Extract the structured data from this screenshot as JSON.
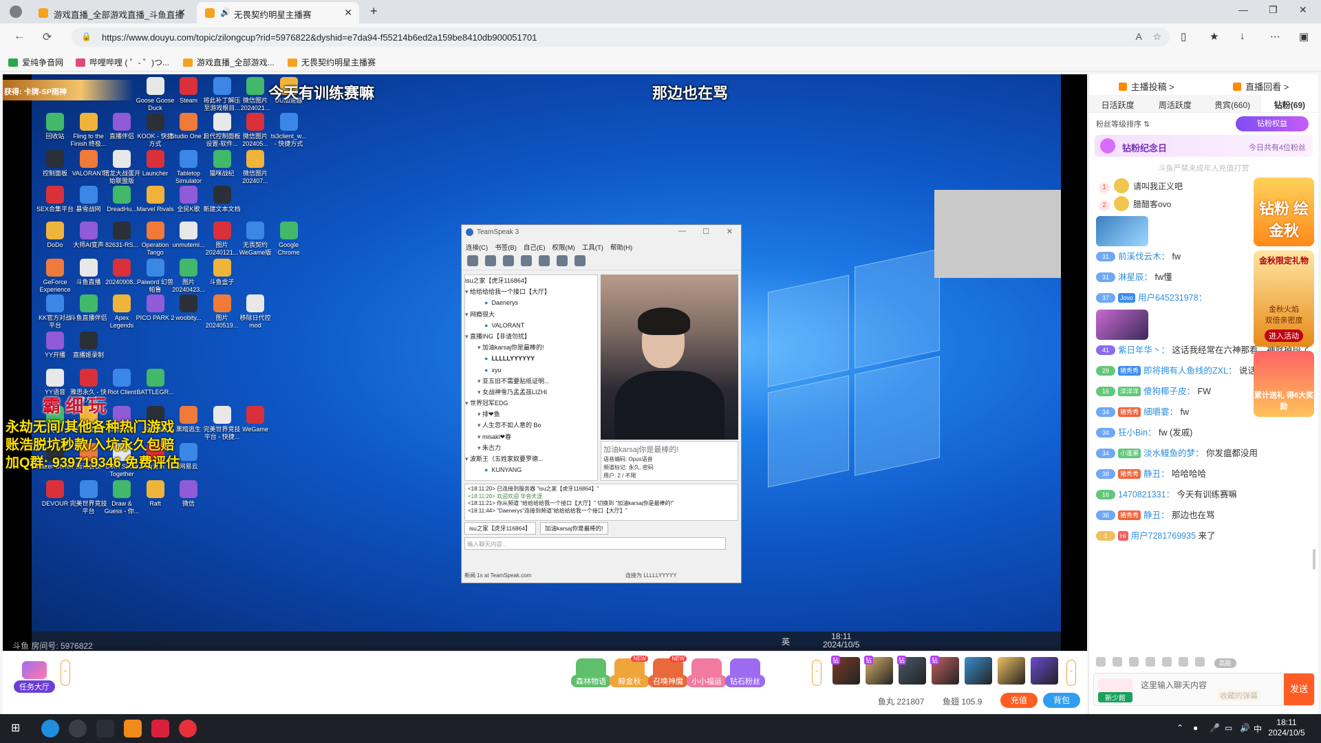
{
  "browser": {
    "tabs": [
      {
        "label": "游戏直播_全部游戏直播_斗鱼直播",
        "active": false
      },
      {
        "label": "无畏契约明星主播赛",
        "active": true
      }
    ],
    "url": "https://www.douyu.com/topic/zilongcup?rid=5976822&dyshid=e7da94-f55214b6ed2a159be8410db900051701",
    "bookmarks": [
      "爱纯争音网",
      "哔哩哔哩 ( ゜- ゜)つ...",
      "游戏直播_全部游戏...",
      "无畏契约明星主播赛"
    ]
  },
  "stream": {
    "got_badge": "获得: 卡牌-SP雨神",
    "overlay_left": "今天有训练赛嘛",
    "overlay_right": "那边也在骂",
    "ad_brand": "霸 细 玩",
    "ad_lines": [
      "永劫无间/其他各种热门游戏",
      "账浩脱坑秒款/入坑永久包赔",
      "加Q群: 939719346 免费评估"
    ],
    "room_no": "斗鱼 房间号: 5976822",
    "inner_clock": {
      "time": "18:11",
      "date": "2024/10/5"
    },
    "inner_lang": "英",
    "desktop_icons": [
      [
        "Goose Goose Duck",
        "Steam",
        "将此补丁解压至游戏根目...",
        "微信图片 2024021...",
        "UU加速器"
      ],
      [
        "回收站",
        "Fling to the Finish 终极...",
        "直播伴侣",
        "KOOK - 快捷方式",
        "Studio One 3",
        "日代控制面板设置-软件...",
        "微信图片 202405...",
        "ts3client_w... - 快捷方式"
      ],
      [
        "控制面板",
        "VALORANT",
        "猎龙大战蛋开始联盟版",
        "Launcher",
        "Tabletop Simulator",
        "猫咪战纪",
        "微信图片 202407..."
      ],
      [
        "SEX合集平台",
        "暴雪战网",
        "DreadHu...",
        "Marvel Rivals",
        "全民K歌",
        "新建文本文档"
      ],
      [
        "DoDo",
        "大师AI变声",
        "82631-RS...",
        "Operation Tango",
        "unmutemi...",
        "图片 20240121...",
        "无畏契约 WeGame版",
        "Google Chrome"
      ],
      [
        "GeForce Experience",
        "斗鱼直播",
        "20240908...",
        "Paiword 幻兽帕鲁",
        "图片 20240423...",
        "斗鱼盒子"
      ],
      [
        "KK官方对战平台",
        "斗鱼直播伴侣",
        "Apex Legends",
        "PICO PARK 2",
        "woobity...",
        "图片 20240519...",
        "移除日代控mod"
      ],
      [
        "YY开播",
        "直播姬录制"
      ],
      [
        "YY语音",
        "雅思永久 - 快捷方式",
        "Riot Client",
        "BATTLEGR..."
      ],
      [
        "QQ",
        "守望先锋",
        "Cuphead",
        "关键造型",
        "黑暗逃生",
        "完美世界竞技平台 - 快捷...",
        "WeGame"
      ],
      [
        "Razer Cortex",
        "腾讯会议",
        "Don't Shout Together",
        "qq音乐",
        "网易云"
      ],
      [
        "DEVOUR",
        "完美世界竞技平台",
        "Draw & Guess - 你...",
        "Raft",
        "微信"
      ]
    ]
  },
  "teamspeak": {
    "title": "TeamSpeak 3",
    "menu": [
      "连接(C)",
      "书签(B)",
      "自己(E)",
      "权限(M)",
      "工具(T)",
      "帮助(H)"
    ],
    "tree": [
      {
        "t": "isu之家【虎牙116864】",
        "k": "srv"
      },
      {
        "t": "给给给给我一个接口【大厅】",
        "k": "ch"
      },
      {
        "t": "Daenerys",
        "k": "u"
      },
      {
        "t": "网瘾很大",
        "k": "ch"
      },
      {
        "t": "VALORANT",
        "k": "u"
      },
      {
        "t": "直播ING【非请勿扰】",
        "k": "ch"
      },
      {
        "t": "加油karsaj你是最棒的!",
        "k": "sub"
      },
      {
        "t": "LLLLLYYYYYY",
        "k": "ub"
      },
      {
        "t": "xyu",
        "k": "u"
      },
      {
        "t": "亚五旧不需要贴纸证明...",
        "k": "sub"
      },
      {
        "t": "女战神雪乃孟孟孩LIZHI",
        "k": "sub"
      },
      {
        "t": "世界冠军EDG",
        "k": "ch"
      },
      {
        "t": "排❤鱼",
        "k": "sub"
      },
      {
        "t": "人生忽不如人意的 Bo",
        "k": "sub"
      },
      {
        "t": "misaki❤春",
        "k": "sub"
      },
      {
        "t": "朱古力",
        "k": "sub"
      },
      {
        "t": "波斯王（五姓家奴要罗德...",
        "k": "ch"
      },
      {
        "t": "KUNYANG",
        "k": "u"
      }
    ],
    "channel_info": "加油karsaj你是最棒的!",
    "channel_info_small": [
      "语音编码: Opus语音",
      "频道标记: 永久, 密码",
      "用户: 2 / 不限"
    ],
    "log": [
      {
        "text": "<18:11:20> 已连接到服务器 \"isu之家【虎牙116864】\"",
        "green": false
      },
      {
        "text": "<18:11:20> 欢迎欢迎 华音天涯",
        "green": true
      },
      {
        "text": "<18:11:21> 你从频道 \"给给给给我一个接口【大厅】\" 切换到 \"加油karsaj你是最棒的!\"",
        "green": false
      },
      {
        "text": "<18:11:44> \"Daenerys\"连接到频道\"给给给给我一个接口【大厅】\"",
        "green": false
      }
    ],
    "tabs": [
      "isu之家【虎牙116864】",
      "加油karsaj你是最棒的!"
    ],
    "input_placeholder": "输入聊天内容...",
    "status_left": "新闻 1s at TeamSpeak.com",
    "status_right": "连接为 LLLLLYYYYY"
  },
  "giftbar": {
    "task_hall": "任务大厅",
    "activities": [
      {
        "label": "森林物语",
        "new": false,
        "color": "#5fbf6b"
      },
      {
        "label": "鲸金秋",
        "new": true,
        "color": "#f0a53a"
      },
      {
        "label": "召唤神魔",
        "new": true,
        "color": "#e86a3a"
      },
      {
        "label": "小小福运",
        "new": false,
        "color": "#f07aa0"
      },
      {
        "label": "钻石粉丝",
        "new": false,
        "color": "#9b6cf2"
      }
    ],
    "new_tag": "NEW",
    "gift_tag": "钻",
    "fish_pills": "鱼丸 221807",
    "fish_fins": "鱼翅 105.9",
    "charge": "充值",
    "bag": "背包"
  },
  "rpanel": {
    "top_links": [
      "主播投稿 >",
      "直播回看 >"
    ],
    "tabs": [
      "日活跃度",
      "周活跃度",
      "贵宾(660)",
      "钻粉(69)"
    ],
    "sort_label": "粉丝等级排序 ⇅",
    "zs_rights": "钻粉权益",
    "anniv_title": "钻粉纪念日",
    "anniv_right": "今日共有4位粉丝",
    "notice": "斗鱼严禁未成年人充值打赏",
    "fans": [
      {
        "no": "1",
        "name": "请叫我正义吧"
      },
      {
        "no": "2",
        "name": "腊醋客ovo"
      }
    ],
    "activity": {
      "a1": "钻粉 绘金秋",
      "a2_title": "金秋限定礼物",
      "a2_sub": "金秋火焰",
      "a2_sub2": "双倍亲密度",
      "a2_btn": "进入活动",
      "a3": "累计送礼 得6大奖励"
    },
    "chat": [
      {
        "lvl": "31",
        "lc": "#6fa8f5",
        "badge": "",
        "bc": "",
        "user": "前溪伐云木：",
        "msg": "fw"
      },
      {
        "lvl": "31",
        "lc": "#6fa8f5",
        "badge": "",
        "bc": "",
        "user": "淋星辰：",
        "msg": "fw懂"
      },
      {
        "lvl": "37",
        "lc": "#6fa8f5",
        "badge": "Jovo",
        "bc": "#3d8bf0",
        "user": "用户645231978：",
        "msg": ""
      },
      {
        "lvl": "41",
        "lc": "#8b6cf0",
        "badge": "",
        "bc": "",
        "user": "紫日年华丶：",
        "msg": "这话我经常在六神那看，神就掉段了"
      },
      {
        "lvl": "29",
        "lc": "#63c77a",
        "badge": "猪秀秀",
        "bc": "#3d8bf0",
        "user": "即将拥有人鱼线的ZXL：",
        "msg": "说话了"
      },
      {
        "lvl": "16",
        "lc": "#63c77a",
        "badge": "洋洋洋",
        "bc": "#63c77a",
        "user": "傻狗椰子皮：",
        "msg": "FW"
      },
      {
        "lvl": "34",
        "lc": "#6fa8f5",
        "badge": "猪秀秀",
        "bc": "#f0643d",
        "user": "細嚼霎：",
        "msg": "fw"
      },
      {
        "lvl": "34",
        "lc": "#6fa8f5",
        "badge": "",
        "bc": "",
        "user": "狂小Bin：",
        "msg": "fw (发戚)"
      },
      {
        "lvl": "34",
        "lc": "#6fa8f5",
        "badge": "小蓬莱",
        "bc": "#63c77a",
        "user": "淡水鳗鱼的梦：",
        "msg": "你发瘟都没用"
      },
      {
        "lvl": "38",
        "lc": "#6fa8f5",
        "badge": "猪秀秀",
        "bc": "#f0643d",
        "user": "静丑：",
        "msg": "哈哈哈哈"
      },
      {
        "lvl": "16",
        "lc": "#63c77a",
        "badge": "",
        "bc": "",
        "user": "1470821331：",
        "msg": "今天有训练赛嘛"
      },
      {
        "lvl": "36",
        "lc": "#6fa8f5",
        "badge": "猪秀秀",
        "bc": "#f0643d",
        "user": "静丑：",
        "msg": "那边也在骂"
      },
      {
        "lvl": "1",
        "lc": "#f0c060",
        "badge": "Hi",
        "bc": "#f06060",
        "user": "用户7281769935",
        "msg": "来了"
      }
    ],
    "hs_label": "高能",
    "fan_tag": "新少館",
    "input_placeholder": "这里输入聊天内容",
    "input_hint": "收藏的弹幕",
    "send": "发送"
  },
  "taskbar": {
    "ime": "中",
    "time": "18:11",
    "date": "2024/10/5"
  }
}
